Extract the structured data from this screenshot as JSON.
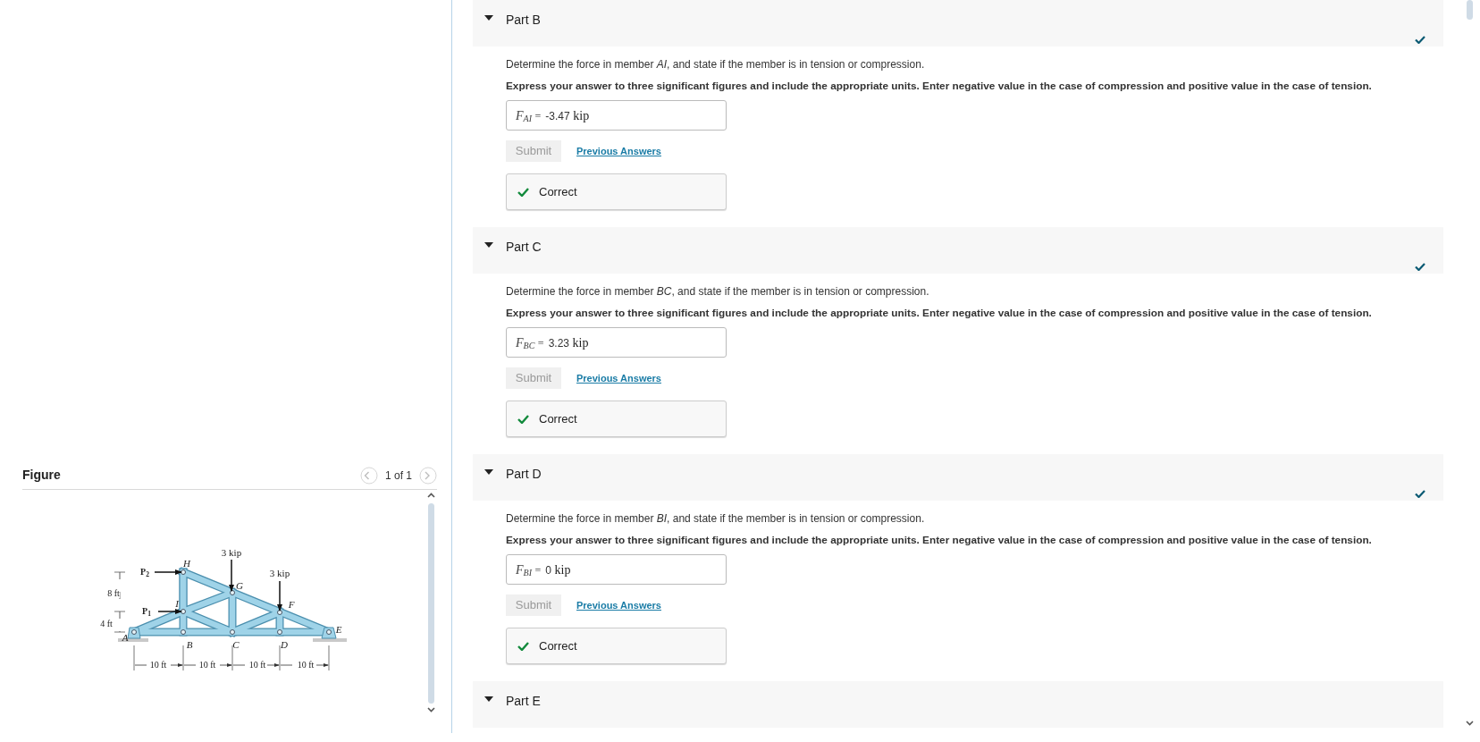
{
  "figure": {
    "title": "Figure",
    "pager": "1 of 1",
    "diagram": {
      "loads": [
        "3 kip",
        "3 kip"
      ],
      "forces": [
        "P$_{2}$",
        "P$_{1}$"
      ],
      "joints": [
        "H",
        "G",
        "F",
        "I",
        "A",
        "B",
        "C",
        "D",
        "E"
      ],
      "heights": [
        "8 ft",
        "4 ft"
      ],
      "spans": [
        "10 ft",
        "10 ft",
        "10 ft",
        "10 ft"
      ]
    }
  },
  "parts": [
    {
      "title": "Part B",
      "expanded": true,
      "completed": true,
      "question": "Determine the force in member *AI*, and state if the member is in tension or compression.",
      "instructions": "Express your answer to three significant figures and include the appropriate units. Enter negative value in the case of compression and positive value in the case of tension.",
      "answer": {
        "symbol": "F",
        "subscript": "AI",
        "equals": "=",
        "value": "-3.47",
        "unit": "kip"
      },
      "submit": "Submit",
      "link": "Previous Answers",
      "feedback": "Correct"
    },
    {
      "title": "Part C",
      "expanded": true,
      "completed": true,
      "question": "Determine the force in member *BC*, and state if the member is in tension or compression.",
      "instructions": "Express your answer to three significant figures and include the appropriate units. Enter negative value in the case of compression and positive value in the case of tension.",
      "answer": {
        "symbol": "F",
        "subscript": "BC",
        "equals": "=",
        "value": "3.23",
        "unit": "kip"
      },
      "submit": "Submit",
      "link": "Previous Answers",
      "feedback": "Correct"
    },
    {
      "title": "Part D",
      "expanded": true,
      "completed": true,
      "question": "Determine the force in member *BI*, and state if the member is in tension or compression.",
      "instructions": "Express your answer to three significant figures and include the appropriate units. Enter negative value in the case of compression and positive value in the case of tension.",
      "answer": {
        "symbol": "F",
        "subscript": "BI",
        "equals": "=",
        "value": "0",
        "unit": "kip"
      },
      "submit": "Submit",
      "link": "Previous Answers",
      "feedback": "Correct"
    },
    {
      "title": "Part E",
      "expanded": true,
      "completed": false
    }
  ]
}
